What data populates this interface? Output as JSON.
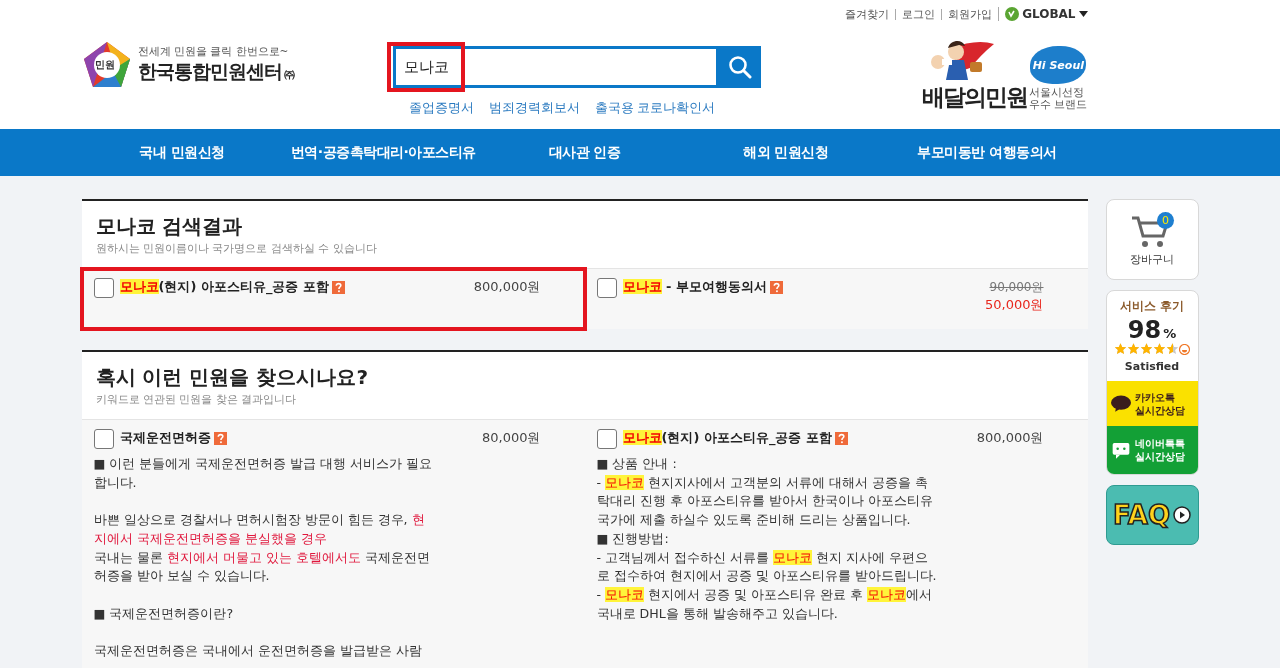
{
  "top_links": [
    {
      "label": "즐겨찾기"
    },
    {
      "label": "로그인"
    },
    {
      "label": "회원가입"
    }
  ],
  "language": "GLOBAL",
  "logo": {
    "mark": "민원",
    "tagline": "전세계 민원을 클릭 한번으로~",
    "name": "한국통합민원센터",
    "suffix": "㈜"
  },
  "search": {
    "value": "모나코",
    "highlighted": true
  },
  "quick_links": [
    "졸업증명서",
    "범죄경력회보서",
    "출국용 코로나확인서"
  ],
  "partner": {
    "name": "배달의민원",
    "badge": "Hi Seoul",
    "caption": [
      "서울시선정",
      "우수 브랜드"
    ]
  },
  "nav": [
    "국내 민원신청",
    "번역·공증촉탁대리·아포스티유",
    "대사관 인증",
    "해외 민원신청",
    "부모미동반 여행동의서"
  ],
  "sections": [
    {
      "title": "모나코 검색결과",
      "subtitle": "원하시는 민원이름이나 국가명으로 검색하실 수 있습니다",
      "items": [
        {
          "checked": false,
          "highlighted": true,
          "title": [
            {
              "text": "모나코",
              "kind": "highlight"
            },
            {
              "text": "(현지) 아포스티유_공증 포함"
            }
          ],
          "price": "800,000원"
        },
        {
          "checked": false,
          "highlighted": false,
          "title": [
            {
              "text": "모나코",
              "kind": "highlight"
            },
            {
              "text": " - 부모여행동의서"
            }
          ],
          "original_price": "90,000원",
          "price": "50,000원"
        }
      ]
    },
    {
      "title": "혹시 이런 민원을 찾으시나요?",
      "subtitle": "키워드로 연관된 민원을 찾은 결과입니다",
      "items": [
        {
          "checked": false,
          "highlighted": false,
          "title": [
            {
              "text": "국제운전면허증"
            }
          ],
          "price": "80,000원",
          "description": [
            {
              "paragraphs": [
                {
                  "segments": [
                    {
                      "text": "■ 이런 분들에게 국제운전면허증 발급 대행 서비스가 필요합니다."
                    }
                  ]
                }
              ]
            },
            {
              "paragraphs": [
                {
                  "segments": [
                    {
                      "text": "바쁜 일상으로 경찰서나 면허시험장 방문이 힘든 경우, "
                    },
                    {
                      "text": "현지에서 국제운전면허증을 분실했을 경우",
                      "kind": "emphasis"
                    }
                  ]
                },
                {
                  "segments": [
                    {
                      "text": "국내는 물론 "
                    },
                    {
                      "text": "현지에서 머물고 있는 호텔에서도",
                      "kind": "emphasis"
                    },
                    {
                      "text": " 국제운전면허증을 받아 보실 수 있습니다."
                    }
                  ]
                }
              ]
            },
            {
              "paragraphs": [
                {
                  "segments": [
                    {
                      "text": "■ 국제운전면허증이란?"
                    }
                  ]
                }
              ]
            },
            {
              "paragraphs": [
                {
                  "segments": [
                    {
                      "text": "국제운전면허증은 국내에서 운전면허증을 발급받은 사람"
                    }
                  ]
                }
              ]
            }
          ]
        },
        {
          "checked": false,
          "highlighted": false,
          "title": [
            {
              "text": "모나코",
              "kind": "highlight"
            },
            {
              "text": "(현지) 아포스티유_공증 포함"
            }
          ],
          "price": "800,000원",
          "description": [
            {
              "paragraphs": [
                {
                  "segments": [
                    {
                      "text": "■ 상품 안내 :"
                    }
                  ]
                },
                {
                  "segments": [
                    {
                      "text": "- "
                    },
                    {
                      "text": "모나코",
                      "kind": "highlight"
                    },
                    {
                      "text": " 현지지사에서 고객분의 서류에 대해서 공증을 촉탁대리 진행 후 아포스티유를 받아서 한국이나 아포스티유 국가에 제출 하실수 있도록 준비해 드리는 상품입니다."
                    }
                  ]
                },
                {
                  "segments": [
                    {
                      "text": "■ 진행방법:"
                    }
                  ]
                },
                {
                  "segments": [
                    {
                      "text": "- 고객님께서 접수하신 서류를 "
                    },
                    {
                      "text": "모나코",
                      "kind": "highlight"
                    },
                    {
                      "text": " 현지 지사에 우편으로 접수하여 현지에서 공증 및 아포스티유를 받아드립니다."
                    }
                  ]
                },
                {
                  "segments": [
                    {
                      "text": "- "
                    },
                    {
                      "text": "모나코",
                      "kind": "highlight"
                    },
                    {
                      "text": " 현지에서 공증 및 아포스티유 완료 후 "
                    },
                    {
                      "text": "모나코",
                      "kind": "highlight"
                    },
                    {
                      "text": "에서 국내로 DHL을 통해 발송해주고 있습니다."
                    }
                  ]
                }
              ]
            }
          ]
        }
      ]
    }
  ],
  "sidebar": {
    "cart": {
      "count": "0",
      "label": "장바구니"
    },
    "review": {
      "title": "서비스 후기",
      "score": "98",
      "unit": "%",
      "stars": 4.5,
      "caption": "Satisfied"
    },
    "consult": [
      {
        "kind": "kakao",
        "lines": [
          "카카오톡",
          "실시간상담"
        ]
      },
      {
        "kind": "naver",
        "lines": [
          "네이버톡톡",
          "실시간상담"
        ]
      }
    ],
    "faq": "FAQ"
  }
}
